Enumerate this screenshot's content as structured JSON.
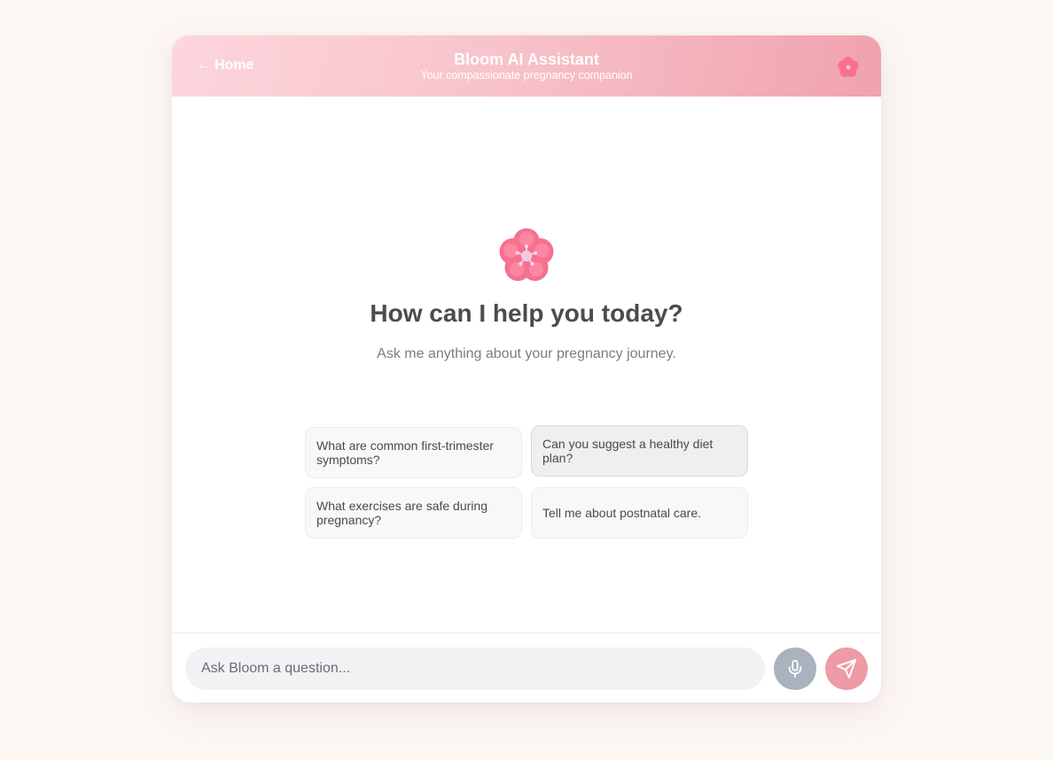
{
  "header": {
    "back_arrow": "←",
    "back_label": "Home",
    "title": "Bloom AI Assistant",
    "subtitle": "Your compassionate pregnancy companion",
    "logo_icon": "cherry-blossom-icon"
  },
  "welcome": {
    "icon": "cherry-blossom-icon",
    "heading": "How can I help you today?",
    "subheading": "Ask me anything about your pregnancy journey."
  },
  "suggestions": [
    "What are common first-trimester symptoms?",
    "Can you suggest a healthy diet plan?",
    "What exercises are safe during pregnancy?",
    "Tell me about postnatal care."
  ],
  "composer": {
    "placeholder": "Ask Bloom a question...",
    "mic_icon": "microphone-icon",
    "send_icon": "send-icon"
  },
  "colors": {
    "page_background": "#fdf7f4",
    "header_gradient_start": "#fdd6dd",
    "header_gradient_end": "#f0a2ad",
    "mic_button": "#aab2bd",
    "send_button": "#ee9ba6",
    "blossom_pink": "#f7708f"
  }
}
